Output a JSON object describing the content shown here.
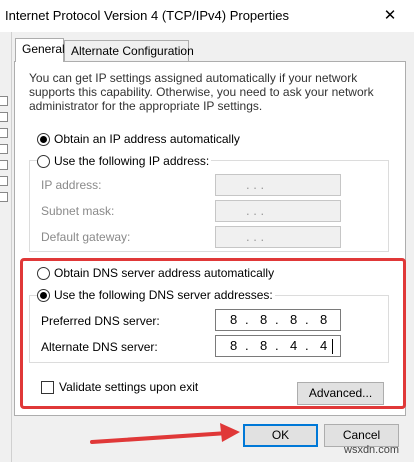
{
  "window": {
    "title": "Internet Protocol Version 4 (TCP/IPv4) Properties",
    "close_symbol": "✕"
  },
  "tabs": [
    {
      "label": "General",
      "selected": true
    },
    {
      "label": "Alternate Configuration",
      "selected": false
    }
  ],
  "description": "You can get IP settings assigned automatically if your network supports this capability. Otherwise, you need to ask your network administrator for the appropriate IP settings.",
  "ip": {
    "auto_label": "Obtain an IP address automatically",
    "auto_selected": true,
    "manual_label": "Use the following IP address:",
    "manual_selected": false,
    "fields": [
      {
        "label": "IP address:",
        "value": ". . ."
      },
      {
        "label": "Subnet mask:",
        "value": ". . ."
      },
      {
        "label": "Default gateway:",
        "value": ". . ."
      }
    ]
  },
  "dns": {
    "auto_label": "Obtain DNS server address automatically",
    "auto_selected": false,
    "manual_label": "Use the following DNS server addresses:",
    "manual_selected": true,
    "preferred_label": "Preferred DNS server:",
    "preferred_octets": [
      "8",
      "8",
      "8",
      "8"
    ],
    "alternate_label": "Alternate DNS server:",
    "alternate_octets": [
      "8",
      "8",
      "4",
      "4"
    ]
  },
  "validate": {
    "label": "Validate settings upon exit",
    "checked": false
  },
  "buttons": {
    "advanced": "Advanced...",
    "ok": "OK",
    "cancel": "Cancel"
  },
  "annotation": {
    "color": "#e03838"
  },
  "watermark": "wsxdn.com"
}
